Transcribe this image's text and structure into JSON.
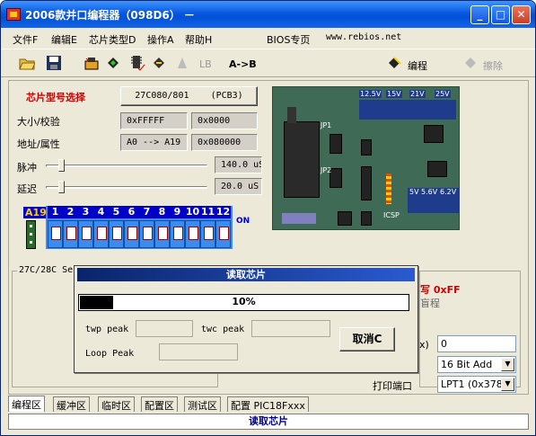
{
  "window": {
    "title": "2006款并口编程器（098D6） －"
  },
  "menubar": {
    "items": [
      "文件F",
      "编辑E",
      "芯片类型D",
      "操作A",
      "帮助H"
    ],
    "bios_label": "BIOS专页",
    "url": "www.rebios.net"
  },
  "toolbar": {
    "lb_label": "LB",
    "ab_label": "A->B",
    "program_label": "编程",
    "erase_label": "擦除"
  },
  "chip": {
    "type_label": "芯片型号选择",
    "type_value": "27C080/801    (PCB3)",
    "size_label": "大小/校验",
    "size_value": "0xFFFFF",
    "checksum_value": "0x0000",
    "addr_label": "地址/属性",
    "addr_value": "A0 --> A19",
    "attr_value": "0x080000",
    "pulse_label": "脉冲",
    "pulse_value": "140.0 uS",
    "delay_label": "延迟",
    "delay_value": "20.0 uS"
  },
  "pins": {
    "a19": "A19",
    "numbers": [
      "1",
      "2",
      "3",
      "4",
      "5",
      "6",
      "7",
      "8",
      "9",
      "10",
      "11",
      "12"
    ],
    "on": "ON"
  },
  "board": {
    "labels": [
      "12.5V",
      "15V",
      "21V",
      "25V",
      "JP1",
      "JP2",
      "ICSP",
      "5V",
      "5.6V",
      "6.2V"
    ]
  },
  "lower": {
    "group_label": "27C/28C Se",
    "right_red": "写 0xFF",
    "right_sub": "盲程",
    "hex_label": "x)",
    "hex_value": "0",
    "bit_value": "16 Bit Add",
    "port_label": "打印端口",
    "port_value": "LPT1 (0x378)"
  },
  "dialog": {
    "title": "读取芯片",
    "progress_text": "10%",
    "progress_fraction": 0.1,
    "twp_label": "twp peak",
    "twc_label": "twc peak",
    "loop_label": "Loop Peak",
    "cancel_label": "取消C"
  },
  "tabs": [
    "编程区",
    "缓冲区",
    "临时区",
    "配置区",
    "测试区",
    "配置 PIC18Fxxx"
  ],
  "status": "读取芯片"
}
